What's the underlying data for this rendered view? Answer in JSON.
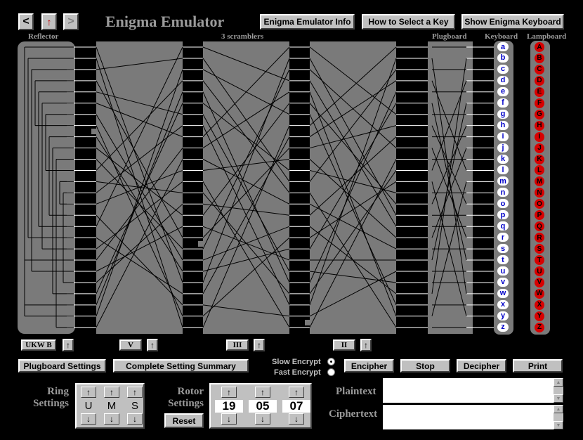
{
  "nav": {
    "back": "<",
    "up": "↑",
    "forward": ">"
  },
  "title": "Enigma Emulator",
  "header_buttons": {
    "info": "Enigma Emulator Info",
    "select_key": "How to Select a Key",
    "show_keyboard": "Show Enigma Keyboard"
  },
  "section_labels": {
    "reflector": "Reflector",
    "scramblers": "3 scramblers",
    "plugboard": "Plugboard",
    "keyboard": "Keyboard",
    "lampboard": "Lampboard"
  },
  "keyboard_keys": [
    "a",
    "b",
    "c",
    "d",
    "e",
    "f",
    "g",
    "h",
    "i",
    "j",
    "k",
    "l",
    "m",
    "n",
    "o",
    "p",
    "q",
    "r",
    "s",
    "t",
    "u",
    "v",
    "w",
    "x",
    "y",
    "z"
  ],
  "lampboard_lamps": [
    "A",
    "B",
    "C",
    "D",
    "E",
    "F",
    "G",
    "H",
    "I",
    "J",
    "K",
    "L",
    "M",
    "N",
    "O",
    "P",
    "Q",
    "R",
    "S",
    "T",
    "U",
    "V",
    "W",
    "X",
    "Y",
    "Z"
  ],
  "rotor_labels": {
    "reflector": "UKW B",
    "left": "V",
    "middle": "III",
    "right": "II",
    "up": "↑"
  },
  "action_buttons": {
    "plugboard_settings": "Plugboard Settings",
    "summary": "Complete Setting Summary",
    "encipher": "Encipher",
    "stop": "Stop",
    "decipher": "Decipher",
    "print": "Print"
  },
  "encrypt_speed": {
    "slow": "Slow Encrypt",
    "fast": "Fast Encrypt",
    "selected": "slow"
  },
  "ring_settings": {
    "label_1": "Ring",
    "label_2": "Settings",
    "values": [
      "U",
      "M",
      "S"
    ],
    "up": "↑",
    "down": "↓"
  },
  "rotor_settings": {
    "label_1": "Rotor",
    "label_2": "Settings",
    "values": [
      "19",
      "05",
      "07"
    ],
    "up": "↑",
    "down": "↓",
    "reset": "Reset"
  },
  "text_fields": {
    "plaintext_label": "Plaintext",
    "ciphertext_label": "Ciphertext",
    "plaintext": "",
    "ciphertext": ""
  },
  "colors": {
    "background": "#000000",
    "panel": "#7a7a7a",
    "lamp": "#d80000",
    "key_text": "#0000c8"
  }
}
